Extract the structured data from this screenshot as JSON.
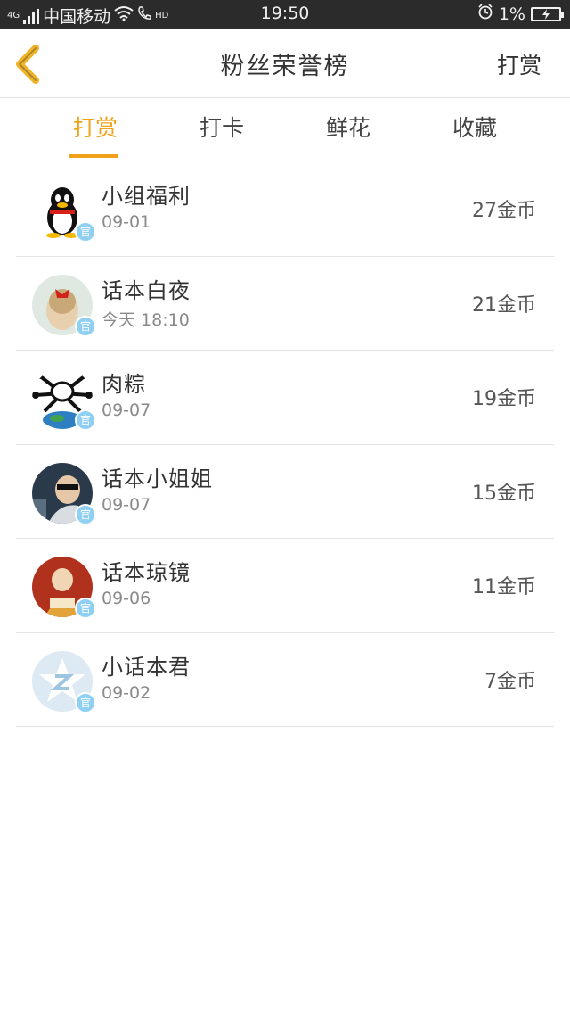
{
  "status_bar": {
    "network": "4G",
    "carrier": "中国移动",
    "hd": "HD",
    "time": "19:50",
    "battery": "1%"
  },
  "nav": {
    "title": "粉丝荣誉榜",
    "action": "打赏",
    "back_icon": "chevron-left-icon",
    "accent": "#f0a21a"
  },
  "tabs": [
    {
      "label": "打赏",
      "active": true
    },
    {
      "label": "打卡",
      "active": false
    },
    {
      "label": "鲜花",
      "active": false
    },
    {
      "label": "收藏",
      "active": false
    }
  ],
  "badge_label": "官",
  "fans": [
    {
      "name": "小组福利",
      "time": "09-01",
      "amount": "27金币"
    },
    {
      "name": "话本白夜",
      "time": "今天 18:10",
      "amount": "21金币"
    },
    {
      "name": "肉粽",
      "time": "09-07",
      "amount": "19金币"
    },
    {
      "name": "话本小姐姐",
      "time": "09-07",
      "amount": "15金币"
    },
    {
      "name": "话本琼镜",
      "time": "09-06",
      "amount": "11金币"
    },
    {
      "name": "小话本君",
      "time": "09-02",
      "amount": "7金币"
    }
  ]
}
